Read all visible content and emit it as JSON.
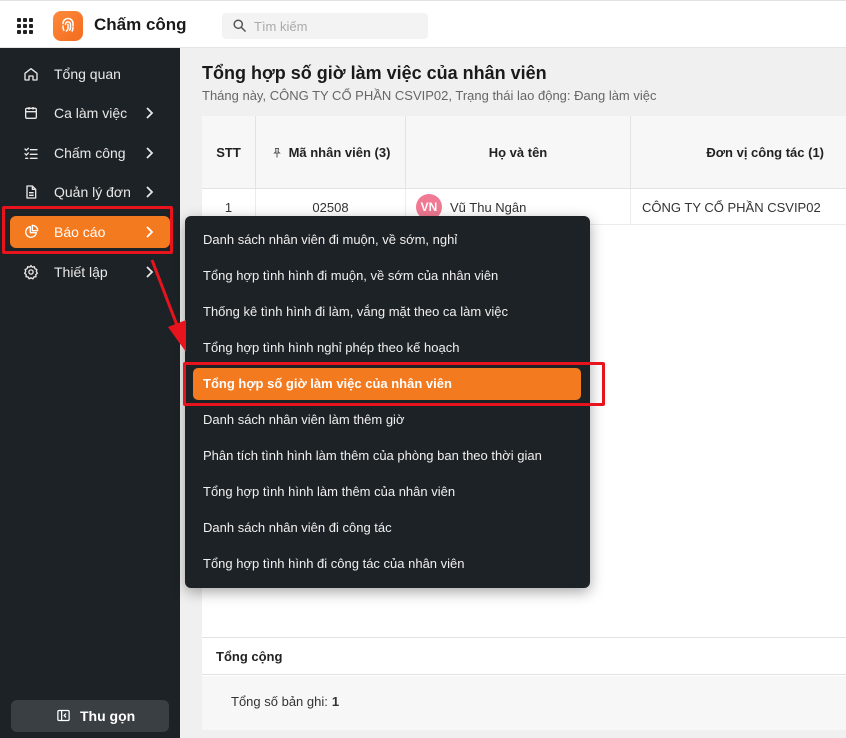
{
  "header": {
    "app_title": "Chấm công",
    "search_placeholder": "Tìm kiếm"
  },
  "sidebar": {
    "items": [
      {
        "label": "Tổng quan",
        "icon": "home-icon",
        "has_chevron": false,
        "active": false
      },
      {
        "label": "Ca làm việc",
        "icon": "calendar-icon",
        "has_chevron": true,
        "active": false
      },
      {
        "label": "Chấm công",
        "icon": "checklist-icon",
        "has_chevron": true,
        "active": false
      },
      {
        "label": "Quản lý đơn",
        "icon": "document-icon",
        "has_chevron": true,
        "active": false
      },
      {
        "label": "Báo cáo",
        "icon": "pie-chart-icon",
        "has_chevron": true,
        "active": true
      },
      {
        "label": "Thiết lập",
        "icon": "gear-icon",
        "has_chevron": true,
        "active": false
      }
    ],
    "collapse_label": "Thu gọn"
  },
  "page": {
    "title": "Tổng hợp số giờ làm việc của nhân viên",
    "subtitle": "Tháng này, CÔNG TY CỔ PHẦN CSVIP02, Trạng thái lao động: Đang làm việc"
  },
  "table": {
    "columns": {
      "stt": "STT",
      "employee_code": "Mã nhân viên (3)",
      "full_name": "Họ và tên",
      "unit": "Đơn vị công tác (1)"
    },
    "rows": [
      {
        "stt": "1",
        "employee_code": "02508",
        "avatar_initials": "VN",
        "full_name": "Vũ Thu Ngân",
        "unit": "CÔNG TY CỔ PHẦN CSVIP02"
      }
    ],
    "total_label": "Tổng cộng",
    "footer_label": "Tổng số bản ghi:",
    "footer_count": "1"
  },
  "dropdown": {
    "items": [
      {
        "label": "Danh sách nhân viên đi muộn, về sớm, nghỉ",
        "active": false
      },
      {
        "label": "Tổng hợp tình hình đi muộn, về sớm của nhân viên",
        "active": false
      },
      {
        "label": "Thống kê tình hình đi làm, vắng mặt theo ca làm việc",
        "active": false
      },
      {
        "label": "Tổng hợp tình hình nghỉ phép theo kế hoạch",
        "active": false
      },
      {
        "label": "Tổng hợp số giờ làm việc của nhân viên",
        "active": true
      },
      {
        "label": "Danh sách nhân viên làm thêm giờ",
        "active": false
      },
      {
        "label": "Phân tích tình hình làm thêm của phòng ban theo thời gian",
        "active": false
      },
      {
        "label": "Tổng hợp tình hình làm thêm của nhân viên",
        "active": false
      },
      {
        "label": "Danh sách nhân viên đi công tác",
        "active": false
      },
      {
        "label": "Tổng hợp tình hình đi công tác của nhân viên",
        "active": false
      }
    ]
  },
  "colors": {
    "accent": "#f47a20",
    "sidebar_bg": "#1d2226",
    "annotation_red": "#e8141d",
    "avatar_bg": "#f07a93"
  }
}
